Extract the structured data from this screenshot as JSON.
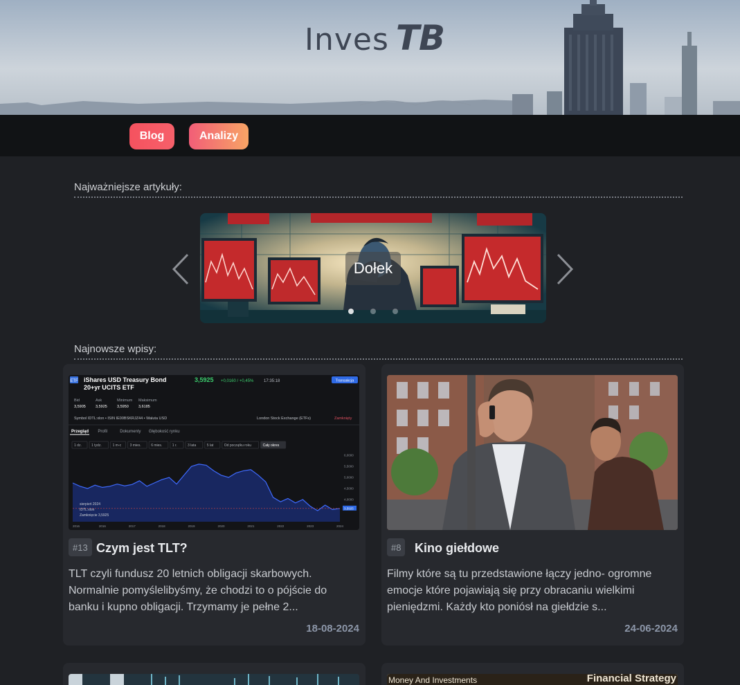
{
  "logo": {
    "part1": "Inves",
    "part2": "TB"
  },
  "nav": {
    "items": [
      {
        "label": "Blog"
      },
      {
        "label": "Analizy"
      }
    ]
  },
  "sections": {
    "featured_title": "Najważniejsze artykuły:",
    "latest_title": "Najnowsze wpisy:"
  },
  "carousel": {
    "caption": "Dołek",
    "slide_count": 3,
    "active_slide": 1
  },
  "posts": [
    {
      "number": "#13",
      "title": "Czym jest TLT?",
      "excerpt": "TLT czyli fundusz 20 letnich obligacji skarbowych. Normalnie pomyślelibyśmy, że chodzi to o pójście do banku i kupno obligacji. Trzymamy je pełne 2...",
      "date": "18-08-2024",
      "image": {
        "etf_badge": "ETF",
        "name_line1": "iShares USD Treasury Bond",
        "name_line2": "20+yr UCITS ETF",
        "price": "3,5925",
        "change": "+0,0160 / +0,45%",
        "time": "17:35:18",
        "trade_button": "Transakcja",
        "stats": [
          {
            "label": "Bid",
            "value": "3,5905"
          },
          {
            "label": "Ask",
            "value": "3,5925"
          },
          {
            "label": "Minimum",
            "value": "3,5950"
          },
          {
            "label": "Maksimum",
            "value": "3,6185"
          }
        ],
        "meta_line": "Symbol IDTL:xlon  •  ISIN IE00BSKRJZ44  •  Waluta USD",
        "exchange": "London Stock Exchange (ETFs)",
        "status": "Zamknięty",
        "tabs": [
          "Przegląd",
          "Profil",
          "Dokumenty",
          "Głębokość rynku"
        ],
        "ranges": [
          "1 dz.",
          "1 tydz.",
          "1 m-c",
          "3 mies.",
          "6 mies.",
          "1 r.",
          "3 lata",
          "5 lat",
          "Od początku roku",
          "Cały okres"
        ],
        "tooltip": [
          "sierpień 2024",
          "IDTL:xlon",
          "Zamknięcie 3,5925"
        ],
        "y_ticks": [
          "6,0000",
          "5,5000",
          "5,0000",
          "4,5000",
          "4,0000",
          "3,5925"
        ],
        "x_ticks": [
          "2016",
          "2016",
          "2017",
          "2018",
          "2019",
          "2020",
          "2021",
          "2022",
          "2023",
          "2024"
        ],
        "chart_series": [
          4.75,
          4.6,
          4.5,
          4.65,
          4.55,
          4.6,
          4.7,
          4.62,
          4.68,
          4.85,
          4.6,
          4.75,
          4.9,
          5.0,
          4.7,
          5.1,
          5.5,
          5.6,
          5.55,
          5.3,
          5.1,
          5.0,
          5.2,
          5.3,
          5.35,
          5.1,
          4.8,
          4.1,
          3.9,
          4.05,
          3.85,
          4.0,
          3.7,
          3.5,
          3.75,
          3.55,
          3.6
        ]
      }
    },
    {
      "number": "#8",
      "title": "Kino giełdowe",
      "excerpt": "Filmy które są tu przedstawione łączy jedno- ogromne emocje które pojawiają się przy obracaniu wielkimi pieniędzmi. Każdy kto poniósł na giełdzie s...",
      "date": "24-06-2024"
    }
  ],
  "more_posts": {
    "right_banner_left": "Money And Investments",
    "right_banner_right": "Financial Strategy"
  },
  "colors": {
    "background": "#1f2125",
    "nav_bar": "#111315",
    "card": "#27292e",
    "accent_red": "#f5525f",
    "accent_orange": "#f7a465"
  }
}
